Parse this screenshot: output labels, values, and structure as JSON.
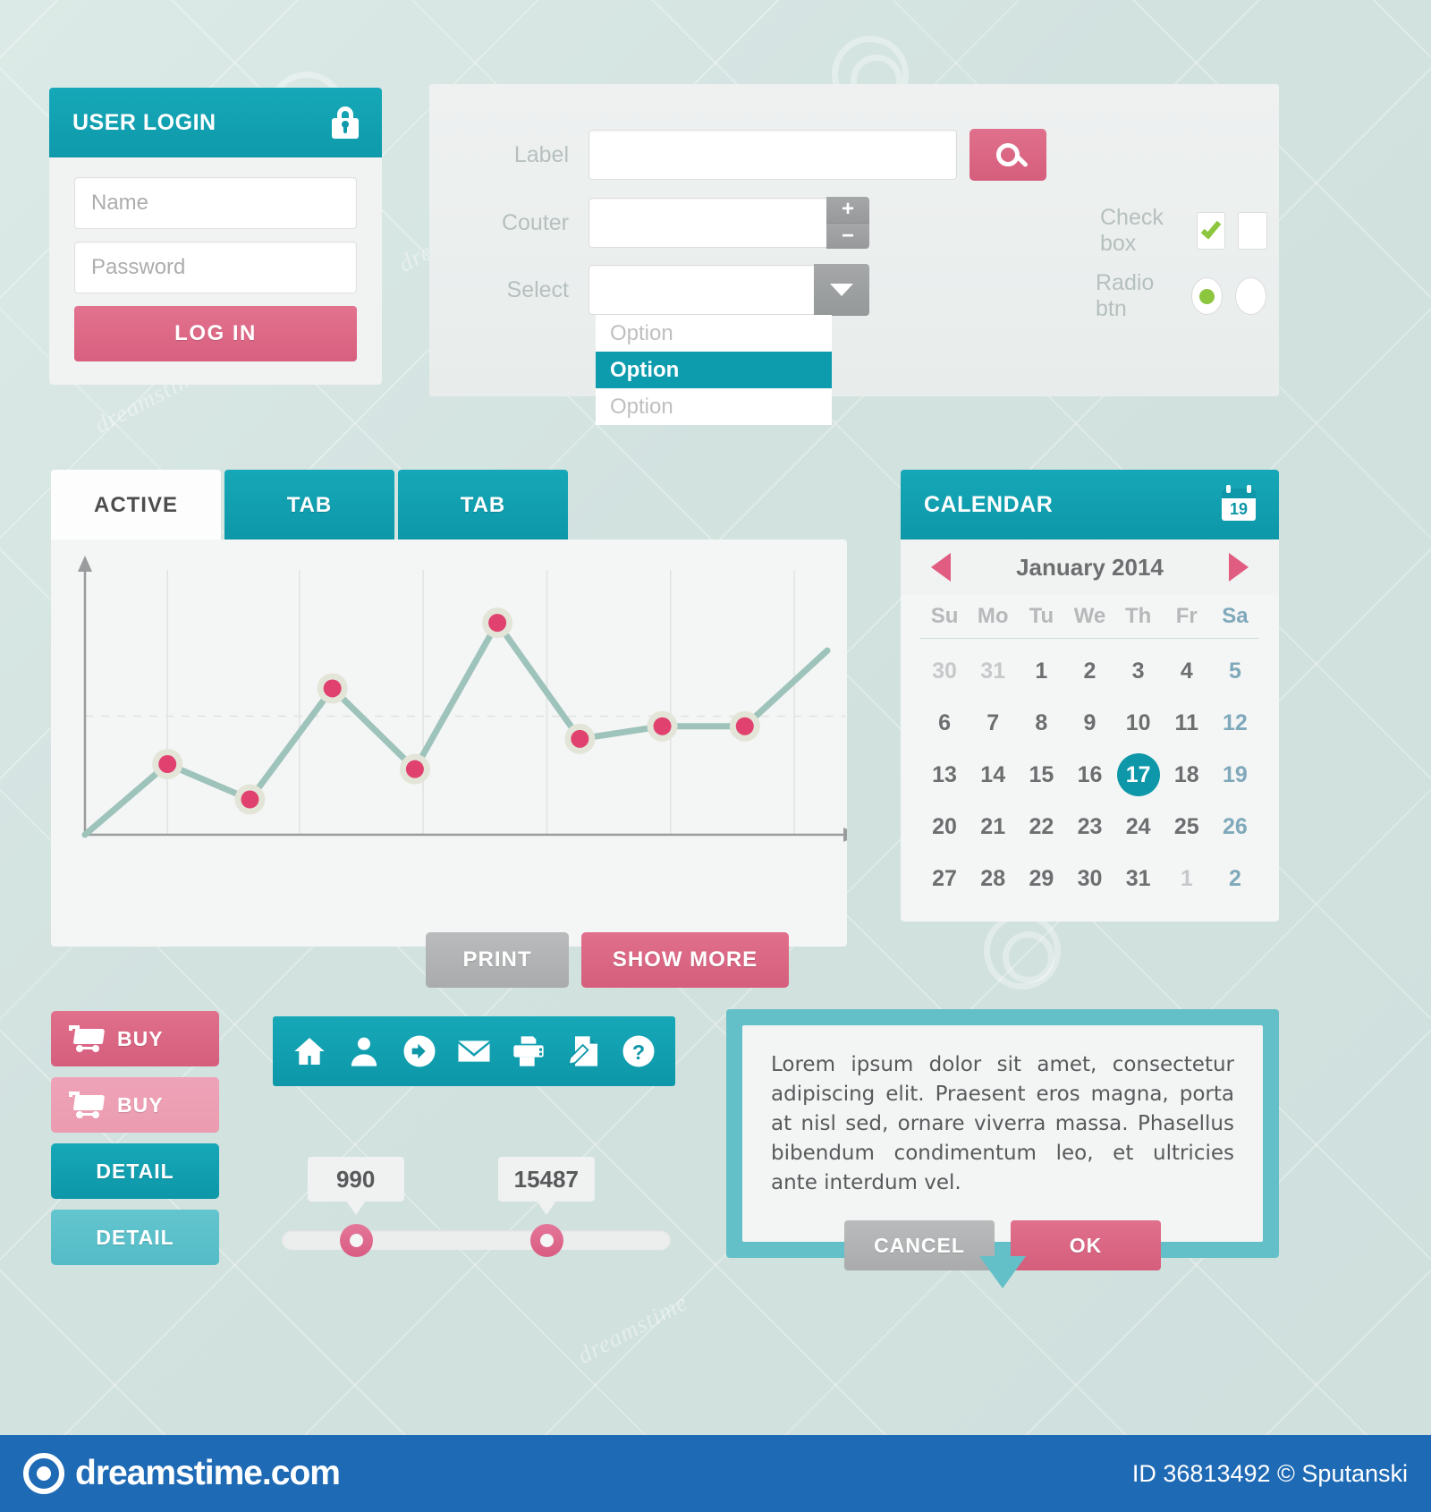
{
  "theme": {
    "teal": "#0d97a8",
    "pink": "#d85f7f",
    "green": "#8cc63e",
    "gray": "#a9abac",
    "background": "#d6e4e2",
    "footer_blue": "#1e6ab5"
  },
  "login": {
    "title": "USER LOGIN",
    "lock_icon": "lock-icon",
    "name_placeholder": "Name",
    "name_value": "",
    "password_placeholder": "Password",
    "password_value": "",
    "submit_label": "LOG IN"
  },
  "form": {
    "label_field": {
      "label": "Label",
      "value": ""
    },
    "counter_field": {
      "label": "Couter",
      "value": "",
      "plus": "+",
      "minus": "−"
    },
    "select_field": {
      "label": "Select",
      "value": "",
      "options": [
        "Option",
        "Option",
        "Option"
      ],
      "selected_index": 1
    },
    "checkbox": {
      "label": "Check box",
      "checked_state": true,
      "unchecked_state": false
    },
    "radio": {
      "label": "Radio btn",
      "checked_state": true,
      "unchecked_state": false
    },
    "search_icon": "search-icon"
  },
  "tabs": [
    {
      "label": "ACTIVE",
      "active": true
    },
    {
      "label": "TAB",
      "active": false
    },
    {
      "label": "TAB",
      "active": false
    }
  ],
  "chart_data": {
    "type": "line",
    "title": "",
    "xlabel": "",
    "ylabel": "",
    "x": [
      0,
      1,
      2,
      3,
      4,
      5,
      6,
      7,
      8,
      9
    ],
    "values": [
      0,
      28,
      14,
      58,
      26,
      84,
      38,
      43,
      43,
      73
    ],
    "xlim": [
      0,
      9
    ],
    "ylim": [
      0,
      100
    ],
    "grid": true,
    "gridlines_x": [
      1,
      2.6,
      4.1,
      5.6,
      7.1,
      8.6
    ],
    "gridline_y": 47,
    "legend": "none",
    "marker": "circle",
    "line_color": "#9dc3bb",
    "marker_fill": "#e0416e",
    "marker_ring": "#e3e5d8",
    "axis_color": "#9a9b9c"
  },
  "chart_actions": {
    "print_label": "PRINT",
    "show_more_label": "SHOW MORE"
  },
  "calendar": {
    "title": "CALENDAR",
    "icon": "calendar-icon",
    "icon_day": "19",
    "prev_icon": "triangle-left-icon",
    "next_icon": "triangle-right-icon",
    "month": "January 2014",
    "dow": [
      "Su",
      "Mo",
      "Tu",
      "We",
      "Th",
      "Fr",
      "Sa"
    ],
    "weeks": [
      [
        {
          "d": "30",
          "muted": true
        },
        {
          "d": "31",
          "muted": true
        },
        {
          "d": "1"
        },
        {
          "d": "2"
        },
        {
          "d": "3"
        },
        {
          "d": "4"
        },
        {
          "d": "5",
          "sat": true
        }
      ],
      [
        {
          "d": "6"
        },
        {
          "d": "7"
        },
        {
          "d": "8"
        },
        {
          "d": "9"
        },
        {
          "d": "10"
        },
        {
          "d": "11"
        },
        {
          "d": "12",
          "sat": true
        }
      ],
      [
        {
          "d": "13"
        },
        {
          "d": "14"
        },
        {
          "d": "15"
        },
        {
          "d": "16"
        },
        {
          "d": "17",
          "today": true
        },
        {
          "d": "18"
        },
        {
          "d": "19",
          "sat": true
        }
      ],
      [
        {
          "d": "20"
        },
        {
          "d": "21"
        },
        {
          "d": "22"
        },
        {
          "d": "23"
        },
        {
          "d": "24"
        },
        {
          "d": "25"
        },
        {
          "d": "26",
          "sat": true
        }
      ],
      [
        {
          "d": "27"
        },
        {
          "d": "28"
        },
        {
          "d": "29"
        },
        {
          "d": "30"
        },
        {
          "d": "31"
        },
        {
          "d": "1",
          "muted": true
        },
        {
          "d": "2",
          "muted": true,
          "sat": true
        }
      ]
    ]
  },
  "action_buttons": [
    {
      "label": "BUY",
      "style": "pink-dark",
      "icon": "cart-icon"
    },
    {
      "label": "BUY",
      "style": "pink-light",
      "icon": "cart-icon"
    },
    {
      "label": "DETAIL",
      "style": "teal-dark",
      "icon": null
    },
    {
      "label": "DETAIL",
      "style": "teal-light",
      "icon": null
    }
  ],
  "icon_bar": [
    "home-icon",
    "user-icon",
    "arrow-right-circle-icon",
    "envelope-icon",
    "printer-icon",
    "document-edit-icon",
    "help-circle-icon"
  ],
  "sliders": [
    {
      "value": "990",
      "position_pct": 19
    },
    {
      "value": "15487",
      "position_pct": 68
    }
  ],
  "tooltip": {
    "text": "Lorem ipsum dolor sit amet, consectetur adipiscing elit. Praesent eros magna, porta at nisl sed, ornare viverra massa. Phasellus bibendum condimentum leo, et ultricies ante interdum vel.",
    "cancel_label": "CANCEL",
    "ok_label": "OK"
  },
  "footer": {
    "brand": "dreamstime.com",
    "meta": "ID 36813492 © Sputanski"
  },
  "watermarks": {
    "text": "dreamstime"
  }
}
